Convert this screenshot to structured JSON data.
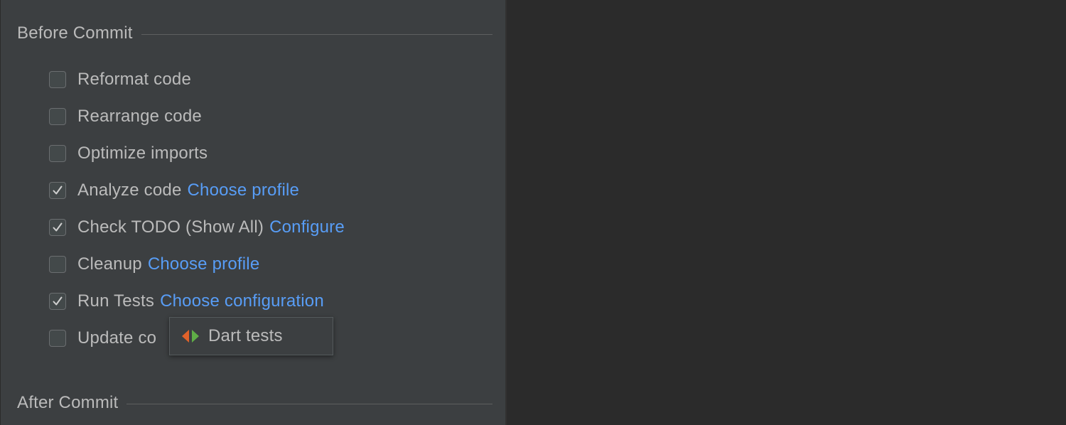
{
  "before_commit": {
    "title": "Before Commit",
    "options": [
      {
        "label": "Reformat code",
        "checked": false,
        "link": ""
      },
      {
        "label": "Rearrange code",
        "checked": false,
        "link": ""
      },
      {
        "label": "Optimize imports",
        "checked": false,
        "link": ""
      },
      {
        "label": "Analyze code",
        "checked": true,
        "link": "Choose profile"
      },
      {
        "label": "Check TODO (Show All)",
        "checked": true,
        "link": "Configure"
      },
      {
        "label": "Cleanup",
        "checked": false,
        "link": "Choose profile"
      },
      {
        "label": "Run Tests",
        "checked": true,
        "link": "Choose configuration"
      },
      {
        "label": "Update co",
        "checked": false,
        "link": ""
      }
    ]
  },
  "popup": {
    "items": [
      {
        "label": "Dart tests",
        "icon": "dart-test-icon"
      }
    ]
  },
  "after_commit": {
    "title": "After Commit"
  },
  "colors": {
    "panel_bg": "#3c3f41",
    "editor_bg": "#2b2b2b",
    "text": "#bbbbbb",
    "link": "#589df6"
  }
}
